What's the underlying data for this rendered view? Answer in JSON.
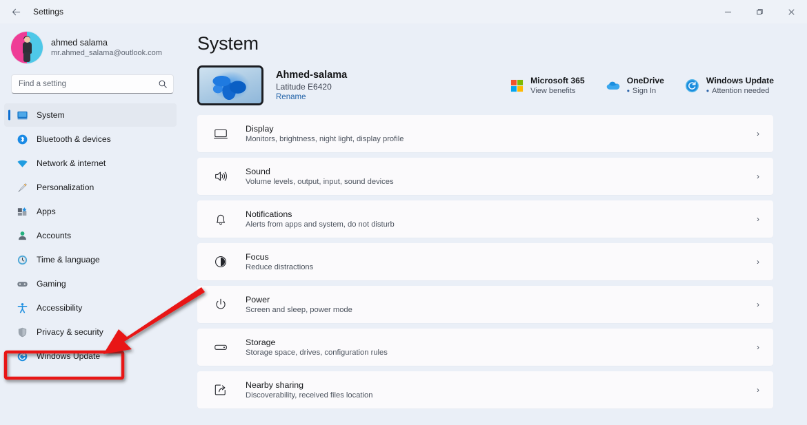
{
  "window": {
    "title": "Settings",
    "back_icon": "back-arrow-icon",
    "minimize_label": "−",
    "maximize_label": "❐",
    "close_label": "✕"
  },
  "sidebar": {
    "profile": {
      "name": "ahmed salama",
      "email": "mr.ahmed_salama@outlook.com",
      "avatar_colors": {
        "left": "#ef3d96",
        "right": "#4ec8e8"
      }
    },
    "search": {
      "placeholder": "Find a setting",
      "value": "",
      "icon": "search-icon"
    },
    "items": [
      {
        "label": "System",
        "icon": "monitor-icon",
        "selected": true
      },
      {
        "label": "Bluetooth & devices",
        "icon": "bluetooth-icon",
        "selected": false
      },
      {
        "label": "Network & internet",
        "icon": "wifi-icon",
        "selected": false
      },
      {
        "label": "Personalization",
        "icon": "paintbrush-icon",
        "selected": false
      },
      {
        "label": "Apps",
        "icon": "apps-icon",
        "selected": false
      },
      {
        "label": "Accounts",
        "icon": "person-icon",
        "selected": false
      },
      {
        "label": "Time & language",
        "icon": "clock-icon",
        "selected": false
      },
      {
        "label": "Gaming",
        "icon": "gamepad-icon",
        "selected": false
      },
      {
        "label": "Accessibility",
        "icon": "accessibility-icon",
        "selected": false
      },
      {
        "label": "Privacy & security",
        "icon": "shield-icon",
        "selected": false
      },
      {
        "label": "Windows Update",
        "icon": "update-refresh-icon",
        "selected": false
      }
    ],
    "accent_color": "#0d6fd1"
  },
  "main": {
    "page_title": "System",
    "device": {
      "name": "Ahmed-salama",
      "model": "Latitude E6420",
      "rename_label": "Rename",
      "thumbnail": "windows-11-bloom-wallpaper"
    },
    "statuses": [
      {
        "title": "Microsoft 365",
        "sub": "View benefits",
        "icon": "microsoft-logo-icon",
        "has_dot": false
      },
      {
        "title": "OneDrive",
        "sub": "Sign In",
        "icon": "onedrive-cloud-icon",
        "has_dot": true
      },
      {
        "title": "Windows Update",
        "sub": "Attention needed",
        "icon": "update-refresh-icon",
        "has_dot": true
      }
    ],
    "rows": [
      {
        "title": "Display",
        "sub": "Monitors, brightness, night light, display profile",
        "icon": "monitor-icon"
      },
      {
        "title": "Sound",
        "sub": "Volume levels, output, input, sound devices",
        "icon": "speaker-icon"
      },
      {
        "title": "Notifications",
        "sub": "Alerts from apps and system, do not disturb",
        "icon": "bell-icon"
      },
      {
        "title": "Focus",
        "sub": "Reduce distractions",
        "icon": "focus-moon-icon"
      },
      {
        "title": "Power",
        "sub": "Screen and sleep, power mode",
        "icon": "power-icon"
      },
      {
        "title": "Storage",
        "sub": "Storage space, drives, configuration rules",
        "icon": "drive-icon"
      },
      {
        "title": "Nearby sharing",
        "sub": "Discoverability, received files location",
        "icon": "share-icon"
      }
    ],
    "chevron": "›"
  },
  "annotation": {
    "color": "#e81212",
    "highlight_target": "Windows Update",
    "shapes": [
      "red-rectangle-highlight",
      "red-arrow-pointer"
    ]
  }
}
